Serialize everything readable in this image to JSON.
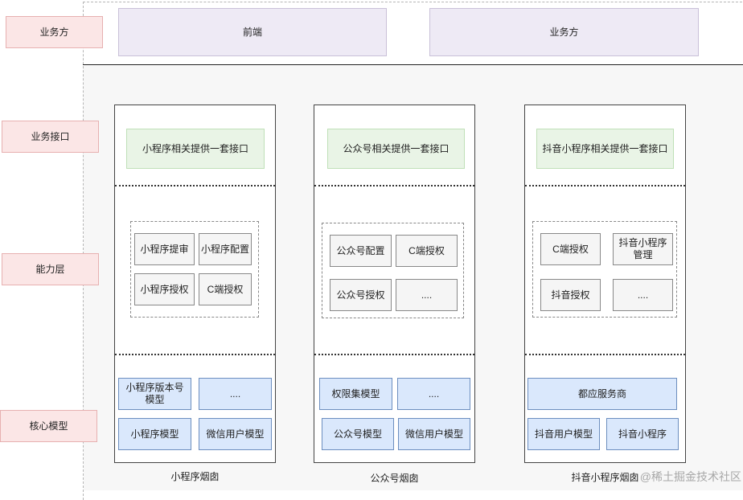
{
  "layers": {
    "top": "业务方",
    "interface": "业务接口",
    "capability": "能力层",
    "core": "核心模型"
  },
  "top_boxes": {
    "front": "前端",
    "business": "业务方"
  },
  "columns": {
    "mini": {
      "interface": "小程序相关提供一套接口",
      "capability": [
        "小程序提审",
        "小程序配置",
        "小程序授权",
        "C端授权"
      ],
      "core": [
        "小程序版本号模型",
        "....",
        "小程序模型",
        "微信用户模型"
      ],
      "caption": "小程序烟囱"
    },
    "official": {
      "interface": "公众号相关提供一套接口",
      "capability": [
        "公众号配置",
        "C端授权",
        "公众号授权",
        "...."
      ],
      "core": [
        "权限集模型",
        "....",
        "公众号模型",
        "微信用户模型"
      ],
      "caption": "公众号烟囱"
    },
    "douyin": {
      "interface": "抖音小程序相关提供一套接口",
      "capability": [
        "C端授权",
        "抖音小程序管理",
        "抖音授权",
        "...."
      ],
      "core": [
        "都应服务商",
        "抖音用户模型",
        "抖音小程序"
      ],
      "caption": "抖音小程序烟囱"
    }
  },
  "watermark": "@稀土掘金技术社区"
}
